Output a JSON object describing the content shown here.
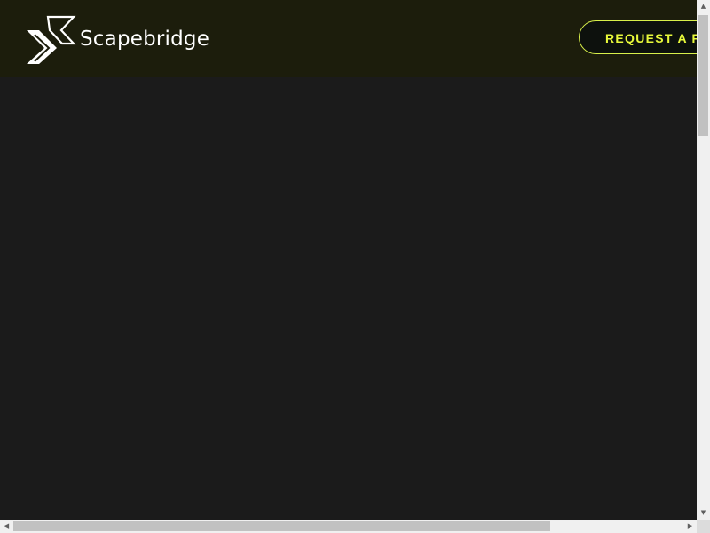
{
  "header": {
    "brand_name": "Scapebridge",
    "cta_label": "REQUEST A FREE CONSULTATION"
  },
  "scrollbars": {
    "up_arrow": "▲",
    "down_arrow": "▼",
    "left_arrow": "◀",
    "right_arrow": "▶"
  },
  "colors": {
    "header_bg": "#1c1d0c",
    "page_bg": "#1b1b1b",
    "accent": "#e8f93a",
    "logo": "#ffffff"
  },
  "icons": {
    "logo": "double-chevron-logo-icon"
  }
}
